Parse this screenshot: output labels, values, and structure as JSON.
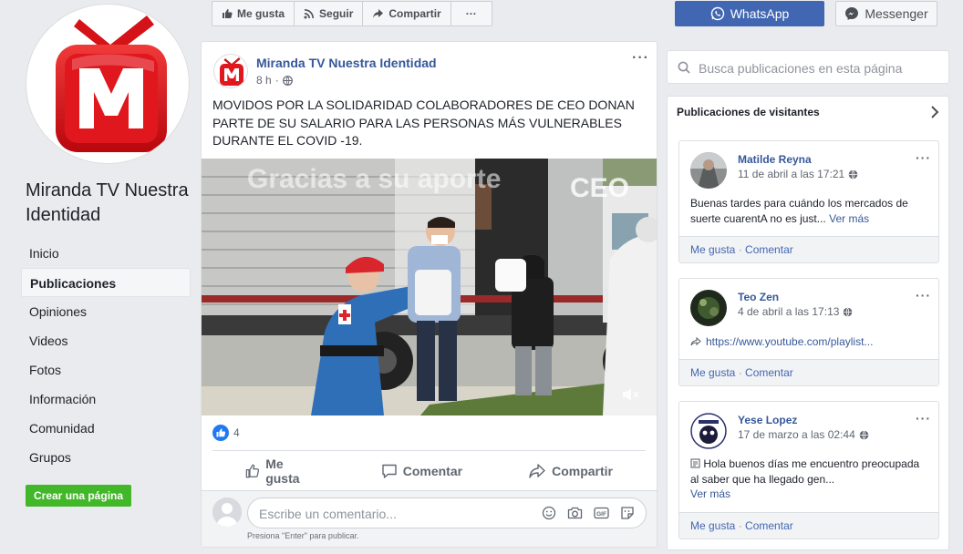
{
  "page": {
    "name": "Miranda TV Nuestra Identidad",
    "nav": [
      "Inicio",
      "Publicaciones",
      "Opiniones",
      "Videos",
      "Fotos",
      "Información",
      "Comunidad",
      "Grupos"
    ],
    "active_nav": "Publicaciones",
    "create_page": "Crear una página"
  },
  "topbar": {
    "like": "Me gusta",
    "follow": "Seguir",
    "share": "Compartir",
    "more": "···",
    "whatsapp": "WhatsApp",
    "messenger": "Messenger"
  },
  "post": {
    "author": "Miranda TV Nuestra Identidad",
    "time": "8 h",
    "more": "···",
    "text": "MOVIDOS POR LA SOLIDARIDAD COLABORADORES DE CEO DONAN PARTE DE SU SALARIO PARA LAS PERSONAS MÁS VULNERABLES DURANTE EL COVID -19.",
    "video_overlay": "Gracias a su aporte",
    "video_brand": "CEO",
    "reaction_count": "4",
    "actions": {
      "like": "Me gusta",
      "comment": "Comentar",
      "share": "Compartir"
    },
    "comment_placeholder": "Escribe un comentario...",
    "comment_hint": "Presiona \"Enter\" para publicar."
  },
  "sidebar_right": {
    "search_placeholder": "Busca publicaciones en esta página",
    "visitors_title": "Publicaciones de visitantes",
    "posts": [
      {
        "name": "Matilde Reyna",
        "time": "11 de abril a las 17:21",
        "text": "Buenas tardes para cuándo los mercados de suerte cuarentA no es just...",
        "more": "Ver más",
        "like": "Me gusta",
        "comment": "Comentar"
      },
      {
        "name": "Teo Zen",
        "time": "4 de abril a las 17:13",
        "text": "https://www.youtube.com/playlist...",
        "like": "Me gusta",
        "comment": "Comentar"
      },
      {
        "name": "Yese Lopez",
        "time": "17 de marzo a las 02:44",
        "text": "Hola buenos días me encuentro preocupada al saber que ha llegado gen...",
        "more": "Ver más",
        "like": "Me gusta",
        "comment": "Comentar"
      }
    ]
  },
  "colors": {
    "background": "#e9ebee",
    "link_blue": "#365899",
    "whatsapp_button": "#4267b2",
    "create_button": "#42b72a",
    "brand_red": "#e1171e"
  }
}
